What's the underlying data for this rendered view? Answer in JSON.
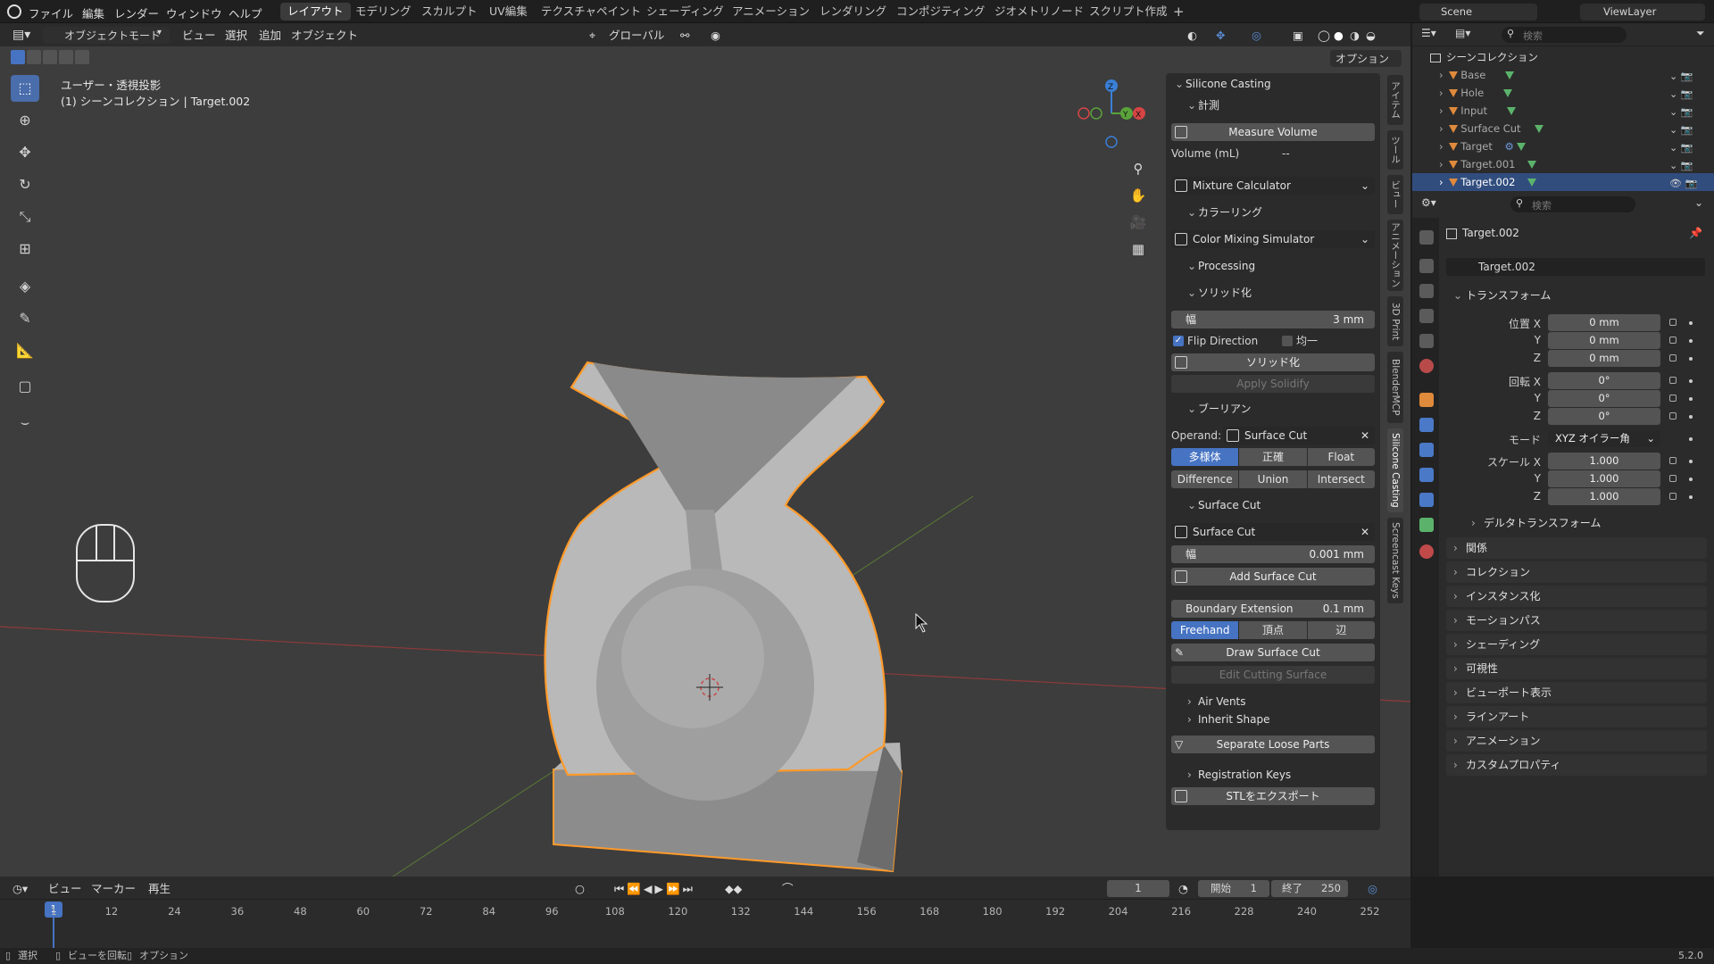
{
  "menu": [
    "ファイル",
    "編集",
    "レンダー",
    "ウィンドウ",
    "ヘルプ"
  ],
  "workspaces": [
    "レイアウト",
    "モデリング",
    "スカルプト",
    "UV編集",
    "テクスチャペイント",
    "シェーディング",
    "アニメーション",
    "レンダリング",
    "コンポジティング",
    "ジオメトリノード",
    "スクリプト作成"
  ],
  "active_workspace": "レイアウト",
  "scene": {
    "name": "Scene",
    "view_layer": "ViewLayer"
  },
  "viewport_header": {
    "mode": "オブジェクトモード",
    "view": "ビュー",
    "select": "選択",
    "add": "追加",
    "object": "オブジェクト",
    "transform_orientation": "グローバル",
    "options": "オプション"
  },
  "viewport_overlay": {
    "line1": "ユーザー・透視投影",
    "line2": "(1) シーンコレクション | Target.002"
  },
  "gizmo": {
    "z": "Z",
    "x": "X",
    "y": "Y"
  },
  "sidebar_tabs": [
    "アイテム",
    "ツール",
    "ビュー",
    "アニメーション",
    "3D Print",
    "BlenderMCP",
    "Silicone Casting",
    "Screencast Keys"
  ],
  "active_sidebar_tab": "Silicone Casting",
  "panel": {
    "title": "Silicone Casting",
    "measure_header": "計測",
    "measure_button": "Measure Volume",
    "volume_label": "Volume (mL)",
    "volume_value": "--",
    "mixture_calculator": "Mixture Calculator",
    "coloring_header": "カラーリング",
    "color_mixing": "Color Mixing Simulator",
    "processing_header": "Processing",
    "solidify_header": "ソリッド化",
    "width_label": "幅",
    "width_value": "3 mm",
    "flip_direction": "Flip Direction",
    "even": "均一",
    "solidify_button": "ソリッド化",
    "apply_solidify": "Apply Solidify",
    "boolean_header": "ブーリアン",
    "operand_label": "Operand:",
    "operand_value": "Surface Cut",
    "solver": [
      "多様体",
      "正確",
      "Float"
    ],
    "operation": [
      "Difference",
      "Union",
      "Intersect"
    ],
    "surface_cut_header": "Surface Cut",
    "surface_cut_object": "Surface Cut",
    "sc_width_label": "幅",
    "sc_width_value": "0.001 mm",
    "add_surface_cut": "Add Surface Cut",
    "boundary_label": "Boundary Extension",
    "boundary_value": "0.1 mm",
    "draw_modes": [
      "Freehand",
      "頂点",
      "辺"
    ],
    "draw_surface_cut": "Draw Surface Cut",
    "edit_cutting_surface": "Edit Cutting Surface",
    "air_vents": "Air Vents",
    "inherit_shape": "Inherit Shape",
    "separate_loose": "Separate Loose Parts",
    "registration_keys": "Registration Keys",
    "export_stl": "STLをエクスポート"
  },
  "outliner": {
    "search_placeholder": "検索",
    "root": "シーンコレクション",
    "items": [
      "Base",
      "Hole",
      "Input",
      "Surface Cut",
      "Target",
      "Target.001",
      "Target.002"
    ],
    "selected": "Target.002"
  },
  "properties": {
    "search_placeholder": "検索",
    "object_name": "Target.002",
    "datablock": "Target.002",
    "transform_header": "トランスフォーム",
    "location_label": "位置 X",
    "location": [
      "0 mm",
      "0 mm",
      "0 mm"
    ],
    "rotation_label": "回転 X",
    "rotation": [
      "0°",
      "0°",
      "0°"
    ],
    "mode_label": "モード",
    "mode_value": "XYZ オイラー角",
    "scale_label": "スケール X",
    "scale": [
      "1.000",
      "1.000",
      "1.000"
    ],
    "axis_y": "Y",
    "axis_z": "Z",
    "delta_transform": "デルタトランスフォーム",
    "sections": [
      "関係",
      "コレクション",
      "インスタンス化",
      "モーションパス",
      "シェーディング",
      "可視性",
      "ビューポート表示",
      "ラインアート",
      "アニメーション",
      "カスタムプロパティ"
    ]
  },
  "timeline": {
    "view": "ビュー",
    "marker": "マーカー",
    "playback": "再生",
    "current_frame": "1",
    "start_label": "開始",
    "start": "1",
    "end_label": "終了",
    "end": "250",
    "frames": [
      "1",
      "12",
      "24",
      "36",
      "48",
      "60",
      "72",
      "84",
      "96",
      "108",
      "120",
      "132",
      "144",
      "156",
      "168",
      "180",
      "192",
      "204",
      "216",
      "228",
      "240",
      "252"
    ]
  },
  "status_bar": {
    "select": "選択",
    "rotate": "ビューを回転",
    "options": "オプション",
    "version": "5.2.0"
  }
}
